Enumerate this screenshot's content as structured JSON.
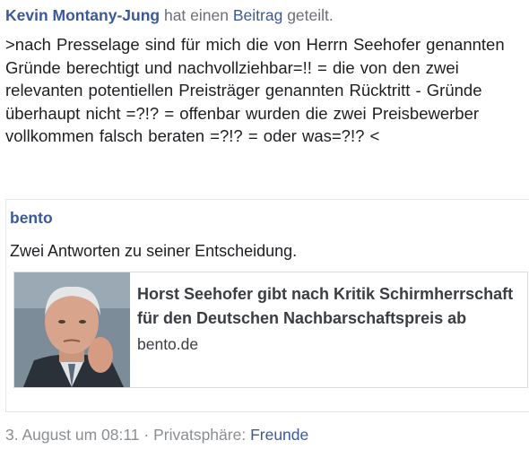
{
  "post": {
    "author": "Kevin Montany-Jung",
    "action_prefix": "hat einen",
    "action_link": "Beitrag",
    "action_suffix": "geteilt.",
    "text": ">nach Presselage sind für mich die von Herrn Seehofer genannten Gründe berechtigt und nachvollziehbar=!! = die von den zwei relevanten potentiellen Preisträger genannten Rücktritt - Gründe überhaupt nicht =?!? = offenbar wurden die zwei Preisbewerber vollkommen falsch beraten =?!? = oder was=?!? <"
  },
  "shared": {
    "source_name": "bento",
    "description": "Zwei Antworten zu seiner Entscheidung.",
    "link": {
      "title": "Horst Seehofer gibt nach Kritik Schirmherrschaft für den Deutschen Nachbarschaftspreis ab",
      "domain": "bento.de"
    }
  },
  "footer": {
    "date": "3. August um 08:11",
    "separator": "·",
    "privacy_label": "Privatsphäre:",
    "audience": "Freunde"
  },
  "colors": {
    "link_blue": "#3b5998",
    "meta_gray": "#8a8d91",
    "border": "#d9dbdf"
  }
}
